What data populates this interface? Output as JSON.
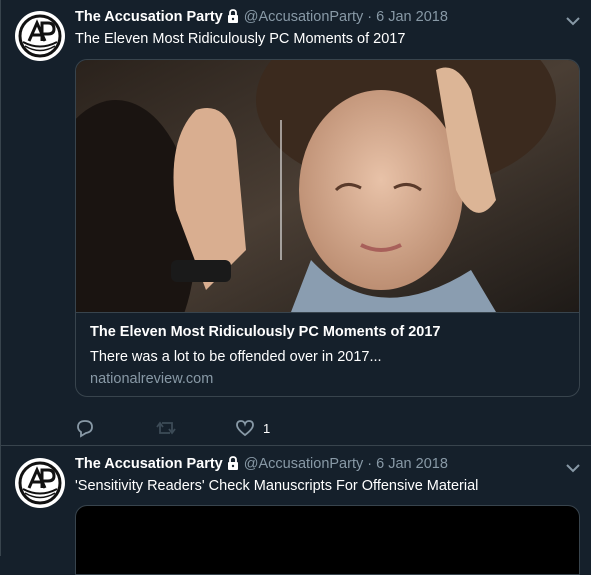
{
  "tweets": [
    {
      "author_name": "The Accusation Party",
      "handle": "@AccusationParty",
      "separator": "·",
      "date": "6 Jan 2018",
      "text": "The Eleven Most Ridiculously PC Moments of 2017",
      "card": {
        "title": "The Eleven Most Ridiculously PC Moments of 2017",
        "description": "There was a lot to be offended over in 2017...",
        "domain": "nationalreview.com"
      },
      "likes": "1"
    },
    {
      "author_name": "The Accusation Party",
      "handle": "@AccusationParty",
      "separator": "·",
      "date": "6 Jan 2018",
      "text": "'Sensitivity Readers' Check Manuscripts For Offensive Material"
    }
  ],
  "colors": {
    "background": "#15202b",
    "border": "#38444d",
    "secondary_text": "#8899a6",
    "primary_text": "#ffffff"
  },
  "icons": {
    "lock": "lock-icon",
    "chevron": "chevron-down-icon",
    "reply": "reply-icon",
    "retweet": "retweet-icon",
    "like": "heart-icon"
  }
}
